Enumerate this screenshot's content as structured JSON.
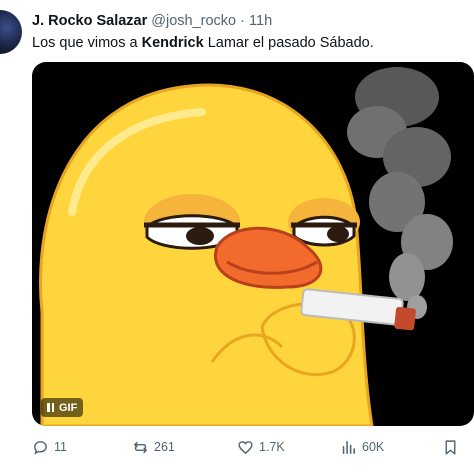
{
  "author": {
    "display_name": "J. Rocko Salazar",
    "handle": "@josh_rocko",
    "separator": "·",
    "time": "11h"
  },
  "post": {
    "text_before": "Los que vimos a ",
    "text_bold": "Kendrick",
    "text_after": " Lamar el pasado Sábado."
  },
  "media": {
    "type": "gif",
    "badge_label": "GIF",
    "icons": [
      "pause-icon"
    ]
  },
  "actions": {
    "replies": "11",
    "reposts": "261",
    "likes": "1.7K",
    "views": "60K",
    "icons": [
      "reply-icon",
      "repost-icon",
      "like-icon",
      "views-icon",
      "bookmark-icon",
      "share-icon"
    ]
  },
  "colors": {
    "text_primary": "#0f1419",
    "text_secondary": "#536471",
    "duck_yellow": "#ffd53d",
    "beak_orange": "#f26b2d",
    "media_background": "#000000"
  }
}
